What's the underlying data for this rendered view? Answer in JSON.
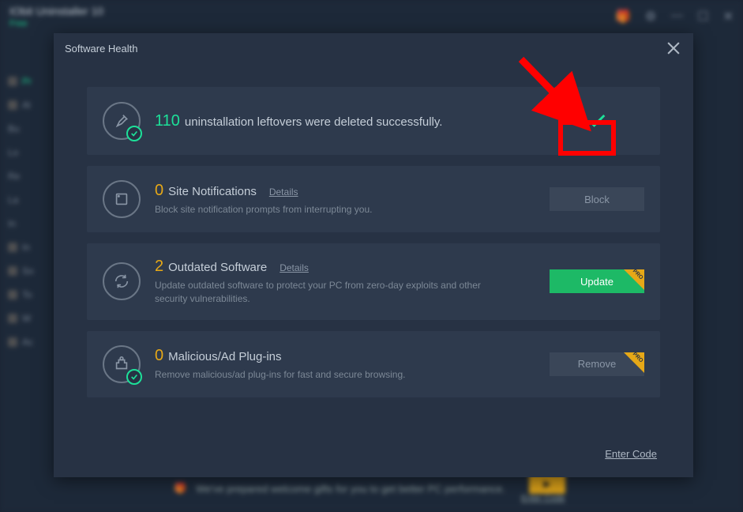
{
  "mainWindow": {
    "title": "IObit Uninstaller 10",
    "edition": "Free",
    "sidebar": [
      "Pr",
      "Al",
      "Bu",
      "Lo",
      "Re",
      "La",
      "In",
      "In",
      "So",
      "To",
      "W",
      "Ac"
    ],
    "banner": {
      "text": "We've prepared welcome gifts for you to get better PC performance.",
      "code": "Enter Code"
    }
  },
  "modal": {
    "title": "Software Health",
    "cards": [
      {
        "count": "110",
        "countClass": "green",
        "label": "uninstallation leftovers were deleted successfully.",
        "desc": "",
        "details": "",
        "action": "check"
      },
      {
        "count": "0",
        "countClass": "orange",
        "label": "Site Notifications",
        "details": "Details",
        "desc": "Block site notification prompts from interrupting you.",
        "action": "Block"
      },
      {
        "count": "2",
        "countClass": "orange",
        "label": "Outdated Software",
        "details": "Details",
        "desc": "Update outdated software to protect your PC from zero-day exploits and other security vulnerabilities.",
        "action": "Update"
      },
      {
        "count": "0",
        "countClass": "orange",
        "label": "Malicious/Ad Plug-ins",
        "details": "",
        "desc": "Remove malicious/ad plug-ins for fast and secure browsing.",
        "action": "Remove"
      }
    ],
    "footer": {
      "enterCode": "Enter Code"
    }
  }
}
